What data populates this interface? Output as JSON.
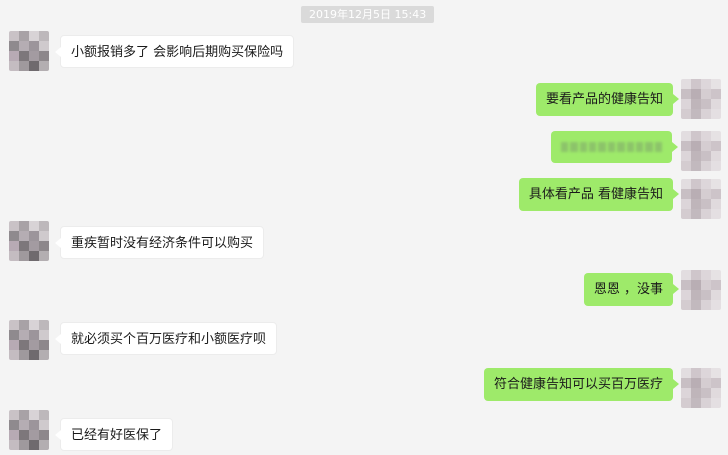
{
  "chat": {
    "timestamp": "2019年12月5日 15:43",
    "messages": [
      {
        "side": "left",
        "text": "小额报销多了 会影响后期购买保险吗"
      },
      {
        "side": "right",
        "text": "要看产品的健康告知"
      },
      {
        "side": "right",
        "text": "",
        "redacted": true
      },
      {
        "side": "right",
        "text": "具体看产品 看健康告知"
      },
      {
        "side": "left",
        "text": "重疾暂时没有经济条件可以购买"
      },
      {
        "side": "right",
        "text": "恩恩 ，没事"
      },
      {
        "side": "left",
        "text": "就必须买个百万医疗和小额医疗呗"
      },
      {
        "side": "right",
        "text": "符合健康告知可以买百万医疗"
      },
      {
        "side": "left",
        "text": "已经有好医保了"
      }
    ]
  },
  "colors": {
    "background": "#f4f4f4",
    "left_bubble": "#ffffff",
    "right_bubble": "#9eea6a",
    "timestamp_bg": "#dadada"
  },
  "icons": {
    "left_avatar": "pixelated-avatar",
    "right_avatar": "pixelated-avatar"
  }
}
